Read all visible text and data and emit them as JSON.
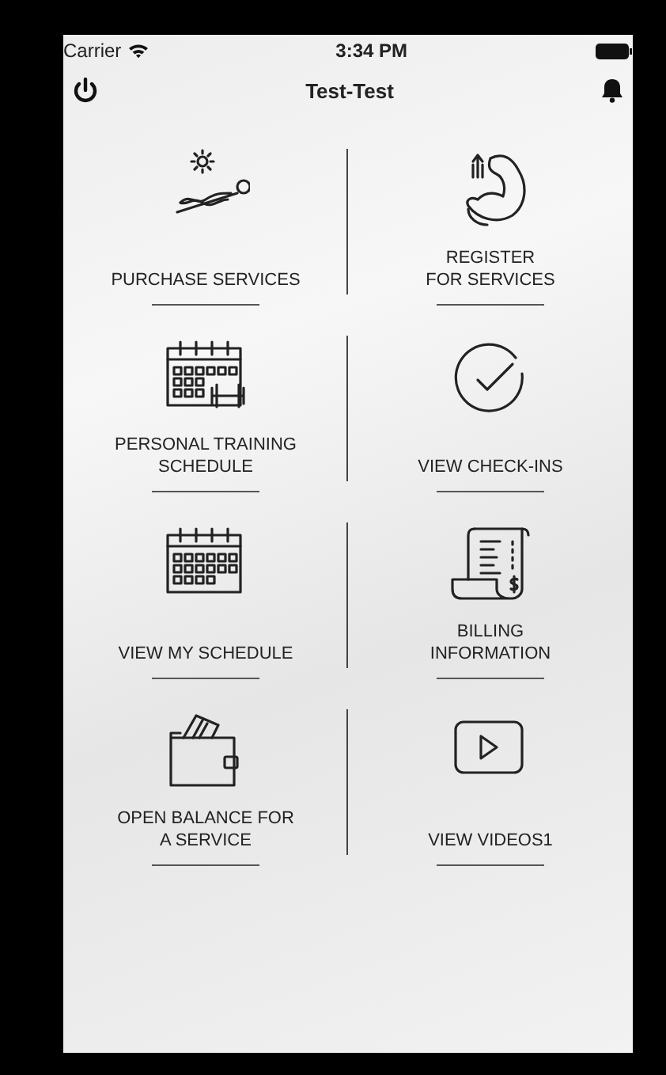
{
  "status_bar": {
    "carrier": "Carrier",
    "time": "3:34 PM"
  },
  "header": {
    "title": "Test-Test"
  },
  "tiles": [
    {
      "label": "PURCHASE SERVICES"
    },
    {
      "label": "REGISTER\nFOR SERVICES"
    },
    {
      "label": "PERSONAL TRAINING\nSCHEDULE"
    },
    {
      "label": "VIEW CHECK-INS"
    },
    {
      "label": "VIEW MY SCHEDULE"
    },
    {
      "label": "BILLING\nINFORMATION"
    },
    {
      "label": "OPEN BALANCE FOR\nA SERVICE"
    },
    {
      "label": "VIEW VIDEOS1"
    }
  ]
}
